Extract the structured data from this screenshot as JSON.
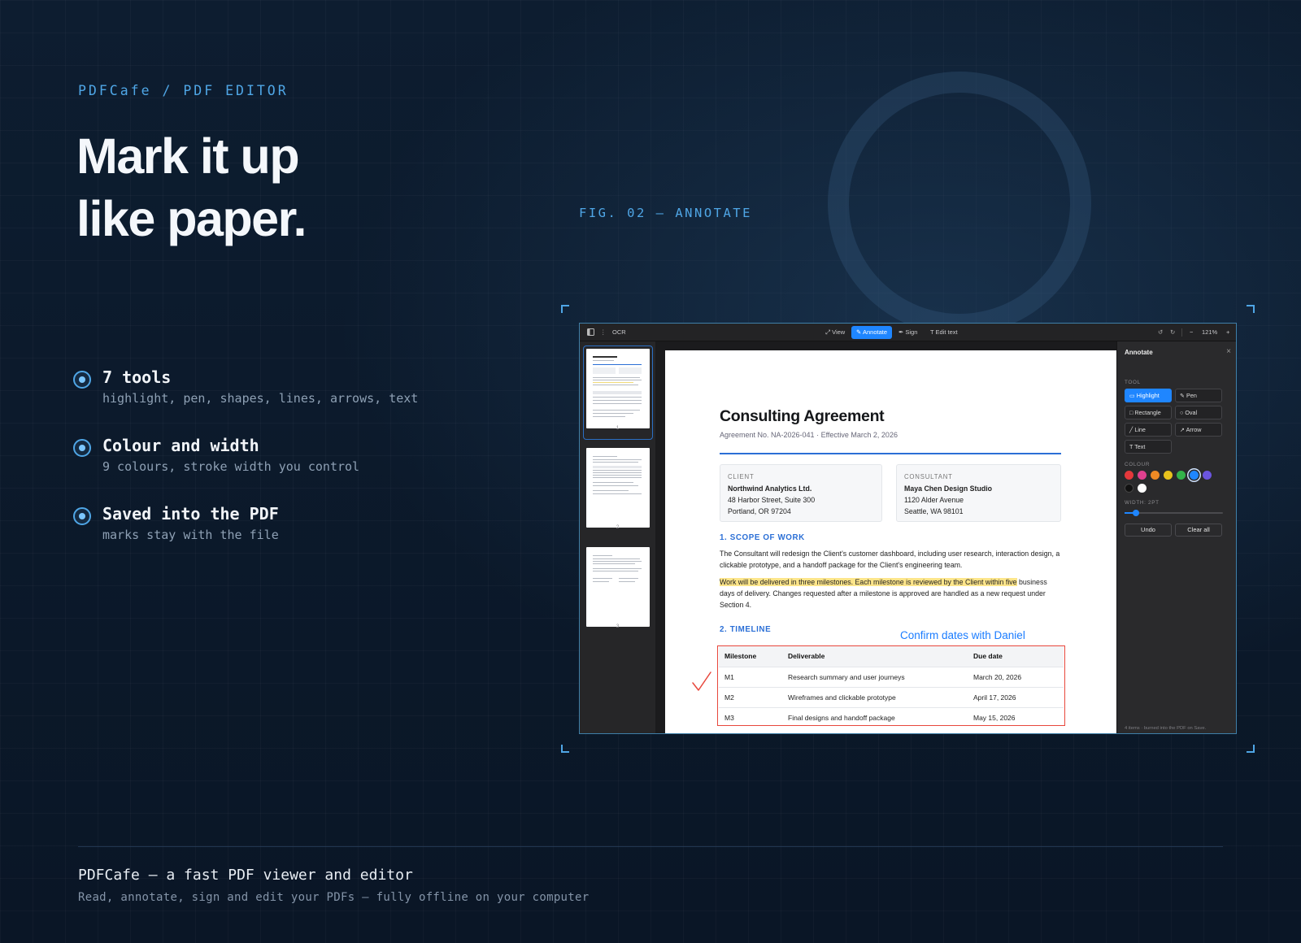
{
  "hero": {
    "eyebrow": "PDFCafe / PDF EDITOR",
    "headline_line1": "Mark it up",
    "headline_line2": "like paper.",
    "figure_label": "FIG. 02 — ANNOTATE"
  },
  "features": [
    {
      "title": "7 tools",
      "desc": "highlight, pen, shapes, lines, arrows, text"
    },
    {
      "title": "Colour and width",
      "desc": "9 colours, stroke width you control"
    },
    {
      "title": "Saved into the PDF",
      "desc": "marks stay with the file"
    }
  ],
  "footer": {
    "title": "PDFCafe — a fast PDF viewer and editor",
    "subtitle": "Read, annotate, sign and edit your PDFs — fully offline on your computer"
  },
  "app": {
    "toolbar": {
      "ocr": "OCR",
      "modes": [
        "View",
        "Annotate",
        "Sign",
        "Edit text"
      ],
      "active_mode": "Annotate",
      "zoom": "121%",
      "zoom_out": "−",
      "zoom_in": "+"
    },
    "thumbnails": {
      "pages": [
        "1",
        "2",
        "3"
      ],
      "selected": "1"
    },
    "document": {
      "title": "Consulting Agreement",
      "subtitle": "Agreement No. NA-2026-041  ·  Effective March 2, 2026",
      "client": {
        "label": "CLIENT",
        "name": "Northwind Analytics Ltd.",
        "line1": "48 Harbor Street, Suite 300",
        "line2": "Portland, OR 97204"
      },
      "consultant": {
        "label": "CONSULTANT",
        "name": "Maya Chen Design Studio",
        "line1": "1120 Alder Avenue",
        "line2": "Seattle, WA 98101"
      },
      "section1_heading": "1. SCOPE OF WORK",
      "section1_p1": "The Consultant will redesign the Client's customer dashboard, including user research, interaction design, a clickable prototype, and a handoff package for the Client's engineering team.",
      "section1_p2_highlighted": "Work will be delivered in three milestones. Each milestone is reviewed by the Client within five",
      "section1_p2_rest": "business days of delivery. Changes requested after a milestone is approved are handled as a new request under Section 4.",
      "section2_heading": "2. TIMELINE",
      "annotation_note": "Confirm dates with Daniel",
      "table": {
        "headers": [
          "Milestone",
          "Deliverable",
          "Due date"
        ],
        "rows": [
          [
            "M1",
            "Research summary and user journeys",
            "March 20, 2026"
          ],
          [
            "M2",
            "Wireframes and clickable prototype",
            "April 17, 2026"
          ],
          [
            "M3",
            "Final designs and handoff package",
            "May 15, 2026"
          ]
        ]
      }
    },
    "panel": {
      "title": "Annotate",
      "tool_label": "TOOL",
      "tools": [
        "Highlight",
        "Pen",
        "Rectangle",
        "Oval",
        "Line",
        "Arrow",
        "Text"
      ],
      "active_tool": "Highlight",
      "colour_label": "COLOUR",
      "colours": [
        "#e5383b",
        "#e0408f",
        "#f08a24",
        "#e8c21c",
        "#33b24a",
        "#1f86ff",
        "#6b55e0",
        "#111111",
        "#ffffff"
      ],
      "selected_colour": "#1f86ff",
      "width_label": "WIDTH: 2PT",
      "width_pt": 2,
      "undo": "Undo",
      "clear_all": "Clear all",
      "status": "4 items · burned into the PDF on Save."
    }
  }
}
